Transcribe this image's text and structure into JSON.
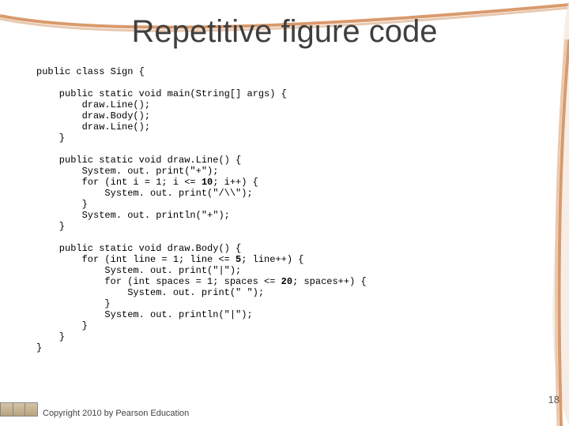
{
  "title": "Repetitive figure code",
  "code_lines": [
    {
      "text": "public class Sign {",
      "indent": 0,
      "bold": false
    },
    {
      "text": "",
      "indent": 0,
      "bold": false
    },
    {
      "text": "public static void main(String[] args) {",
      "indent": 1,
      "bold": false
    },
    {
      "text": "draw.Line();",
      "indent": 2,
      "bold": false
    },
    {
      "text": "draw.Body();",
      "indent": 2,
      "bold": false
    },
    {
      "text": "draw.Line();",
      "indent": 2,
      "bold": false
    },
    {
      "text": "}",
      "indent": 1,
      "bold": false
    },
    {
      "text": "",
      "indent": 0,
      "bold": false
    },
    {
      "text": "public static void draw.Line() {",
      "indent": 1,
      "bold": false
    },
    {
      "text": "System. out. print(\"+\");",
      "indent": 2,
      "bold": false
    },
    {
      "prefix": "for (int i = 1; i <= ",
      "bold_part": "10",
      "suffix": "; i++) {",
      "indent": 2,
      "type": "mixed"
    },
    {
      "text": "System. out. print(\"/\\\\\");",
      "indent": 3,
      "bold": false
    },
    {
      "text": "}",
      "indent": 2,
      "bold": false
    },
    {
      "text": "System. out. println(\"+\");",
      "indent": 2,
      "bold": false
    },
    {
      "text": "}",
      "indent": 1,
      "bold": false
    },
    {
      "text": "",
      "indent": 0,
      "bold": false
    },
    {
      "text": "public static void draw.Body() {",
      "indent": 1,
      "bold": false
    },
    {
      "prefix": "for (int line = 1; line <= ",
      "bold_part": "5",
      "suffix": "; line++) {",
      "indent": 2,
      "type": "mixed"
    },
    {
      "text": "System. out. print(\"|\");",
      "indent": 3,
      "bold": false
    },
    {
      "prefix": "for (int spaces = 1; spaces <= ",
      "bold_part": "20",
      "suffix": "; spaces++) {",
      "indent": 3,
      "type": "mixed"
    },
    {
      "text": "System. out. print(\" \");",
      "indent": 4,
      "bold": false
    },
    {
      "text": "}",
      "indent": 3,
      "bold": false
    },
    {
      "text": "System. out. println(\"|\");",
      "indent": 3,
      "bold": false
    },
    {
      "text": "}",
      "indent": 2,
      "bold": false
    },
    {
      "text": "}",
      "indent": 1,
      "bold": false
    },
    {
      "text": "}",
      "indent": 0,
      "bold": false
    }
  ],
  "page_number": "18",
  "copyright": "Copyright 2010 by Pearson Education"
}
